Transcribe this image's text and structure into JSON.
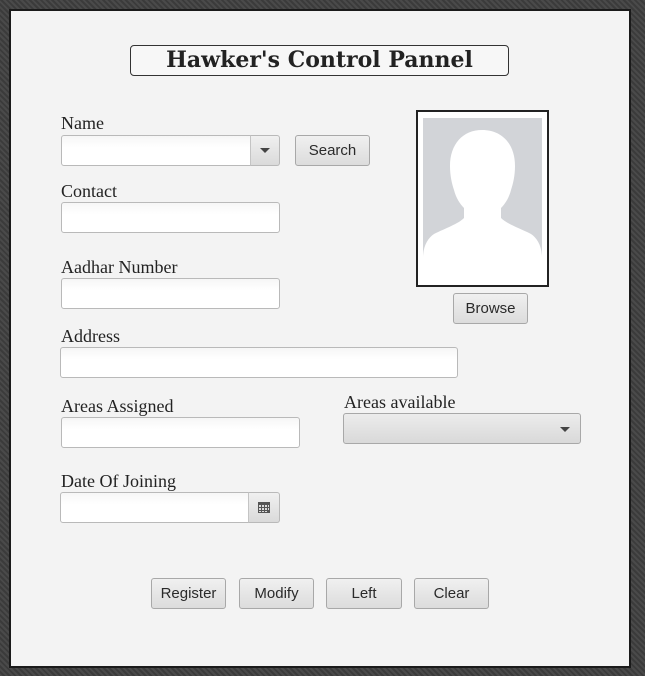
{
  "header": {
    "title": "Hawker's Control Pannel"
  },
  "form": {
    "name_label": "Name",
    "name_value": "",
    "search_label": "Search",
    "contact_label": "Contact",
    "contact_value": "",
    "aadhar_label": "Aadhar Number",
    "aadhar_value": "",
    "address_label": "Address",
    "address_value": "",
    "areas_assigned_label": "Areas Assigned",
    "areas_assigned_value": "",
    "areas_available_label": "Areas available",
    "areas_available_value": "",
    "doj_label": "Date Of Joining",
    "doj_value": ""
  },
  "photo": {
    "browse_label": "Browse",
    "icon": "avatar-placeholder-icon"
  },
  "actions": {
    "register_label": "Register",
    "modify_label": "Modify",
    "left_label": "Left",
    "clear_label": "Clear"
  },
  "colors": {
    "window_bg": "#f3f3f3",
    "button_bg": "#e2e2e2",
    "photo_bg": "#d2d4d8"
  }
}
